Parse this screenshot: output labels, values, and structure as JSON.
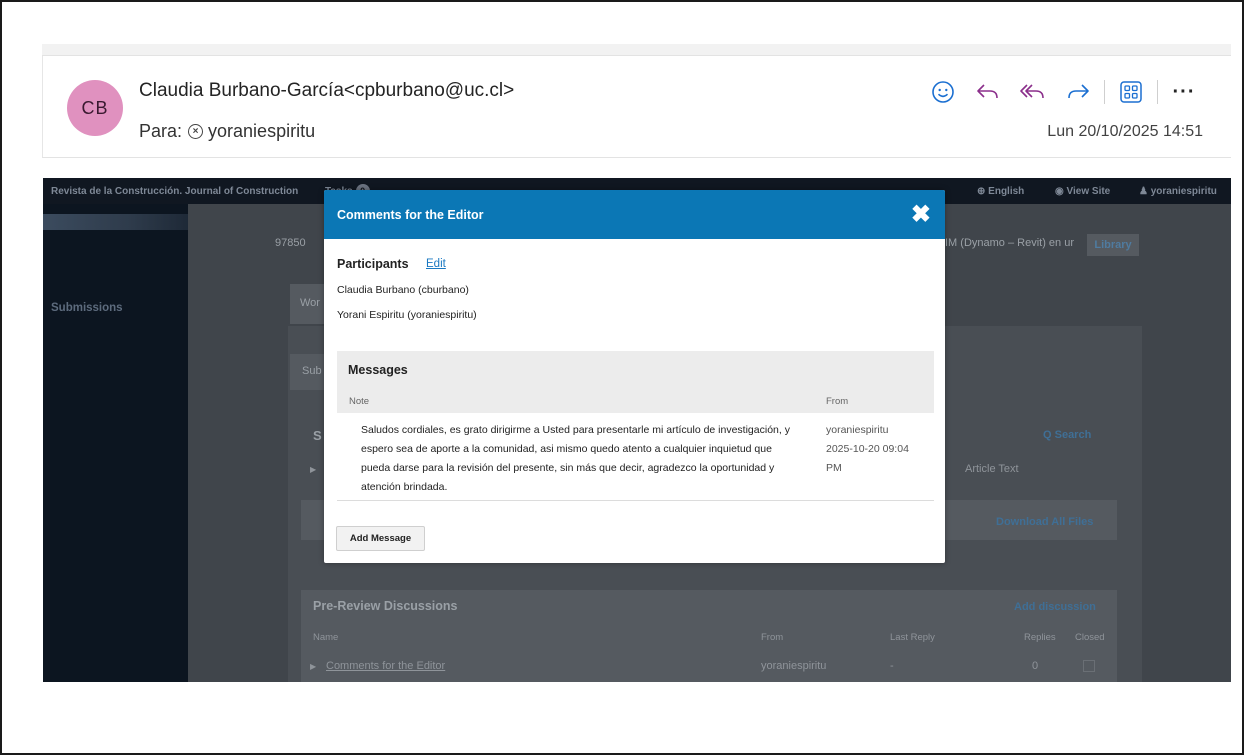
{
  "email": {
    "avatar_initials": "CB",
    "sender": "Claudia Burbano-García<cpburbano@uc.cl>",
    "to_label": "Para:",
    "recipient": "yoraniespiritu",
    "date": "Lun 20/10/2025 14:51",
    "toolbar": {
      "emoji_icon": "smiley-icon",
      "reply_icon": "reply-icon",
      "reply_all_icon": "reply-all-icon",
      "forward_icon": "forward-icon",
      "apps_icon": "apps-grid-icon",
      "more_label": "···"
    },
    "colors": {
      "avatar_bg": "#e091bf",
      "toolbar_accent": "#1b6fd1",
      "reply_all_accent": "#8b2f8b"
    }
  },
  "ojs": {
    "site_title": "Revista de la Construcción. Journal of Construction",
    "tasks_label": "Tasks",
    "tasks_count": "0",
    "language": "English",
    "view_site": "View Site",
    "username": "yoraniespiritu",
    "nav_submissions": "Submissions",
    "breadcrumb_id": "97850",
    "breadcrumb_title_fragment": "IM (Dynamo – Revit) en ur",
    "library_button": "Library",
    "tab_workflow_fragment": "Wor",
    "tab_submission_fragment": "Sub",
    "section_fragment": "S",
    "search_label": "Q  Search",
    "article_text": "Article Text",
    "download_all": "Download All Files",
    "pre_review": {
      "title": "Pre-Review Discussions",
      "add_discussion": "Add discussion",
      "columns": [
        "Name",
        "From",
        "Last Reply",
        "Replies",
        "Closed"
      ],
      "rows": [
        {
          "name": "Comments for the Editor",
          "from": "yoraniespiritu",
          "last_reply": "-",
          "replies": "0"
        }
      ]
    }
  },
  "modal": {
    "title": "Comments for the Editor",
    "close_label": "✖",
    "participants_label": "Participants",
    "edit_label": "Edit",
    "participants": [
      "Claudia Burbano (cburbano)",
      "Yorani Espiritu (yoraniespiritu)"
    ],
    "messages": {
      "heading": "Messages",
      "col_note": "Note",
      "col_from": "From",
      "items": [
        {
          "note": "Saludos cordiales, es grato dirigirme a Usted para presentarle mi artículo de investigación, y espero sea de aporte a la comunidad, asi mismo quedo atento a cualquier inquietud que pueda darse para la revisión del presente, sin más que decir, agradezco la oportunidad y atención brindada.",
          "from_user": "yoraniespiritu",
          "from_date": "2025-10-20 09:04 PM"
        }
      ]
    },
    "add_message_label": "Add Message",
    "colors": {
      "header_bg": "#0b77b5",
      "link": "#1a78c2"
    }
  }
}
